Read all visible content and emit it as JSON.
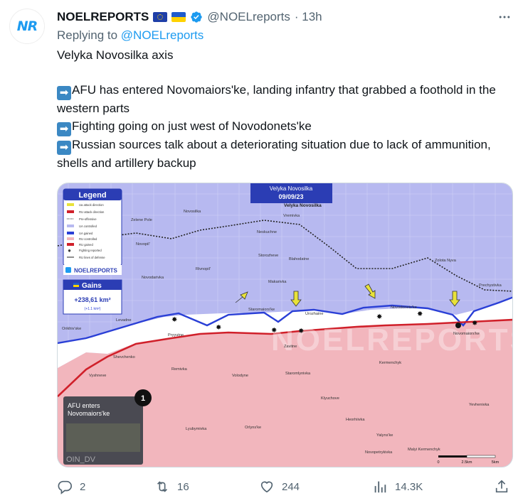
{
  "author": {
    "avatar_text": "NR",
    "name": "NOELREPORTS",
    "handle": "@NOELreports",
    "time": "· 13h"
  },
  "reply": {
    "prefix": "Replying to",
    "handle": "@NOELreports"
  },
  "tweet": {
    "line1": "Velyka Novosilka axis",
    "bullet1": "AFU has entered Novomaiors'ke, landing infantry that grabbed a foothold in the western parts",
    "bullet2": "Fighting going on just west of Novodonets'ke",
    "bullet3": "Russian sources talk about a deteriorating situation due to lack of ammunition, shells and artillery backup"
  },
  "map": {
    "title": "Velyka Novosilka",
    "date": "09/09/23",
    "legend_title": "Legend",
    "legend_items": [
      "Ua attack direction",
      "RU attack direction",
      "Pre-offensive",
      "UA controlled",
      "UA gained",
      "RU controlled",
      "RU gained",
      "Fighting reported",
      "RU lines of defense"
    ],
    "brand": "NOELREPORTS",
    "gains_label": "Gains",
    "gains_value": "+238,61 km²",
    "gains_sub": "(+1.1 km²)",
    "watermark": "NOELREPORTS",
    "inset_caption_1": "AFU enters",
    "inset_caption_2": "Novomaiors'ke",
    "inset_tag": "OIN_DV",
    "marker_number": "1",
    "scale_labels": [
      "0",
      "2.5km",
      "5km"
    ],
    "towns": [
      "Velyka Novosilka",
      "Zelene Pole",
      "Novosilka",
      "Vremivka",
      "Neskuchne",
      "Novopil'",
      "Storozheve",
      "Blahodatne",
      "Zolota Nyva",
      "Rivnopil'",
      "Novodarivka",
      "Makarivka",
      "Prechystivka",
      "Staromaiors'ke",
      "Urozhaine",
      "Novodonets'ke",
      "Levadne",
      "Orikhiv'ske",
      "Pryyutne",
      "Novomaiors'ke",
      "Zavitne",
      "Shevchenko",
      "Kermenchyk",
      "Vyshneve",
      "Remivka",
      "Volodyne",
      "Staromlynivka",
      "Klyuchove",
      "Yevhenivka",
      "Heorhiivka",
      "Lyubymivka",
      "Orlyns'ke",
      "Yalyns'ke",
      "Novopetrykivka",
      "Malyi Kermenchyk"
    ]
  },
  "actions": {
    "replies": "2",
    "retweets": "16",
    "likes": "244",
    "views": "14.3K"
  },
  "colors": {
    "ua_blue": "#b7b9f0",
    "ru_red": "#f2b6bd",
    "accent": "#1d9bf0"
  }
}
